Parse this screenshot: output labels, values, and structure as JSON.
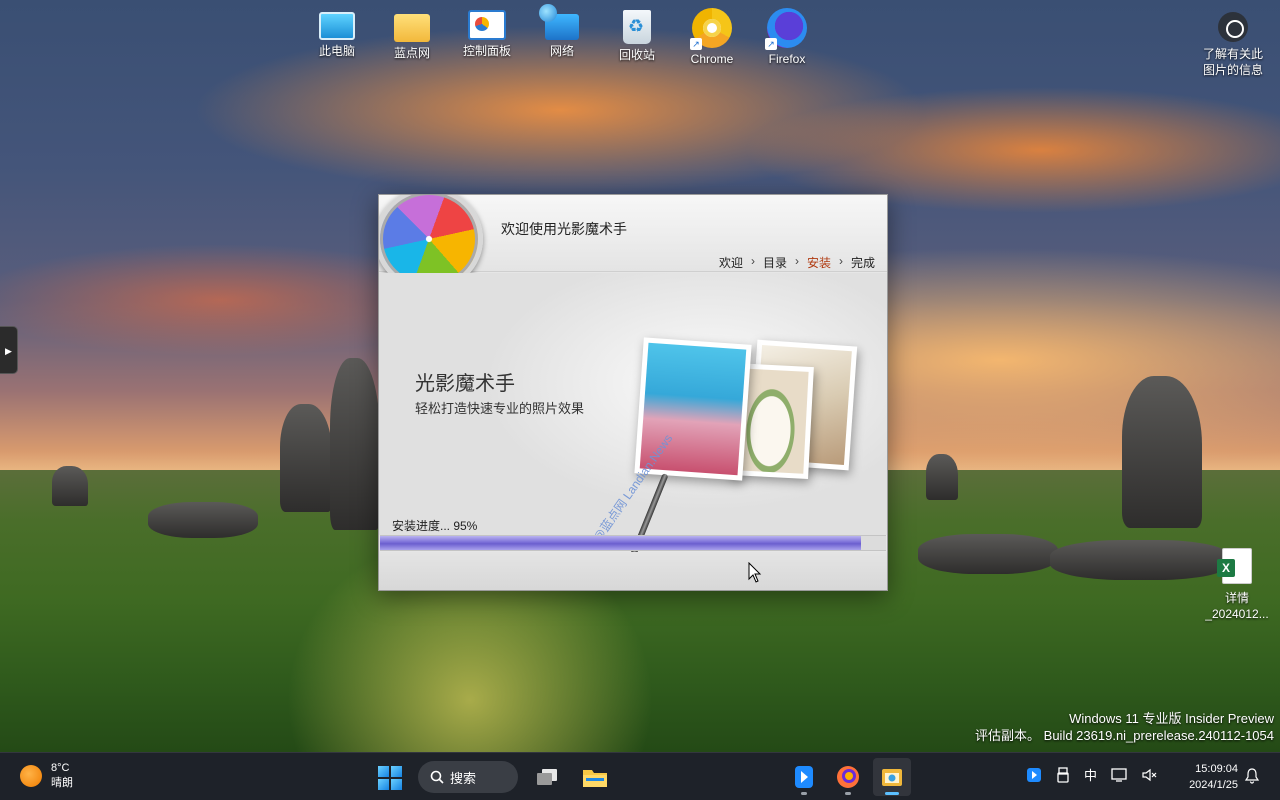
{
  "desktop": {
    "icons": [
      {
        "label": "此电脑"
      },
      {
        "label": "蓝点网"
      },
      {
        "label": "控制面板"
      },
      {
        "label": "网络"
      },
      {
        "label": "回收站"
      },
      {
        "label": "Chrome"
      },
      {
        "label": "Firefox"
      }
    ],
    "info_label_line1": "了解有关此",
    "info_label_line2": "图片的信息",
    "excel_file_line1": "详情",
    "excel_file_line2": "_2024012...",
    "watermark_line1": "Windows 11 专业版 Insider Preview",
    "watermark_line2": "评估副本。 Build 23619.ni_prerelease.240112-1054"
  },
  "installer": {
    "title": "欢迎使用光影魔术手",
    "steps": [
      "欢迎",
      "目录",
      "安装",
      "完成"
    ],
    "active_step": "安装",
    "product_name": "光影魔术手",
    "product_tagline": "轻松打造快速专业的照片效果",
    "site_watermark": "@蓝点网 Landian.News",
    "progress_label": "安装进度... 95%",
    "progress_fraction": 0.95
  },
  "taskbar": {
    "weather_temp": "8°C",
    "weather_desc": "晴朗",
    "search_label": "搜索",
    "ime_label": "中",
    "time": "15:09:04",
    "date": "2024/1/25"
  },
  "colors": {
    "accent": "#5cc0ff",
    "active_step": "#b03a10",
    "progress": "#7a6ed8"
  }
}
